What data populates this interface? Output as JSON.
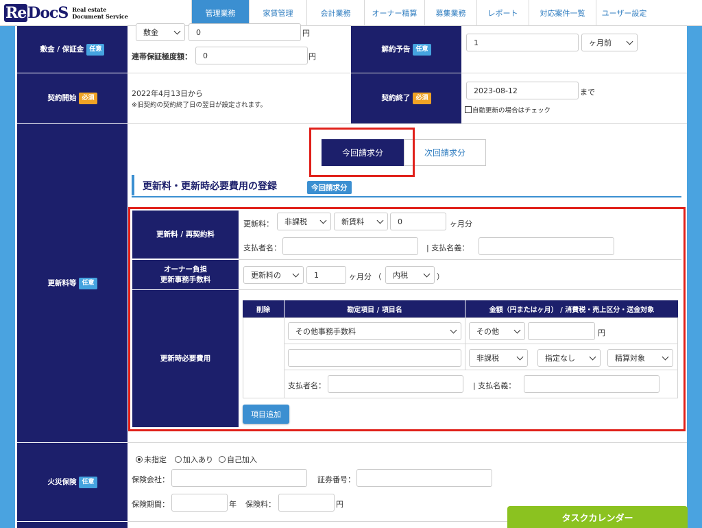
{
  "logo": {
    "mark_re": "Re",
    "mark_docs": "DocS",
    "sub_line1": "Real estate",
    "sub_line2": "Document Service"
  },
  "nav": {
    "tabs": [
      "管理業務",
      "家賃管理",
      "会計業務",
      "オーナー精算",
      "募集業務",
      "レポート",
      "対応案件一覧",
      "ユーザー設定"
    ],
    "active_index": 0
  },
  "badges": {
    "optional": "任意",
    "required": "必須"
  },
  "deposit": {
    "label": "敷金 / 保証金",
    "type_value": "敷金",
    "amount_value": "0",
    "yen": "円",
    "guarantee_label": "連帯保証極度額：",
    "guarantee_value": "0",
    "guarantee_yen": "円"
  },
  "cancel_notice": {
    "label": "解約予告",
    "value": "1",
    "unit_value": "ヶ月前"
  },
  "contract_start": {
    "label": "契約開始",
    "text": "2022年4月13日から",
    "note": "※旧契約の契約終了日の翌日が設定されます。"
  },
  "contract_end": {
    "label": "契約終了",
    "value": "2023-08-12",
    "suffix": "まで",
    "auto_renew": "自動更新の場合はチェック"
  },
  "renewal": {
    "label": "更新料等",
    "toggle_current": "今回請求分",
    "toggle_next": "次回請求分",
    "section_title": "更新料・更新時必要費用の登録",
    "section_badge": "今回請求分",
    "fee_label": "更新料 / 再契約料",
    "fee_prefix": "更新料：",
    "fee_tax": "非課税",
    "fee_base": "新賃料",
    "fee_months": "0",
    "fee_months_unit": "ヶ月分",
    "payer_name_label": "支払者名：",
    "payee_name_label": "|  支払名義：",
    "owner_label_1": "オーナー負担",
    "owner_label_2": "更新事務手数料",
    "owner_base": "更新料の",
    "owner_months": "1",
    "owner_months_unit": "ヶ月分 （",
    "owner_tax": "内税",
    "owner_close": "）",
    "required_cost_label": "更新時必要費用",
    "table_headers": [
      "削除",
      "勘定項目 / 項目名",
      "金額（円またはヶ月） / 消費税・売上区分・送金対象"
    ],
    "item_account": "その他事務手数料",
    "item_kind": "その他",
    "item_yen": "円",
    "item_tax": "非課税",
    "item_spec": "指定なし",
    "item_target": "精算対象",
    "item_payer_label": "支払者名：",
    "item_payee_label": "|  支払名義：",
    "add_button": "項目追加"
  },
  "fire_insurance": {
    "label": "火災保険",
    "options": [
      "未指定",
      "加入あり",
      "自己加入"
    ],
    "selected_index": 0,
    "company_label": "保険会社：",
    "cert_label": "証券番号：",
    "period_label": "保険期間：",
    "period_unit": "年",
    "fee_label": "保険料：",
    "fee_unit": "円"
  },
  "task_calendar": "タスクカレンダー"
}
